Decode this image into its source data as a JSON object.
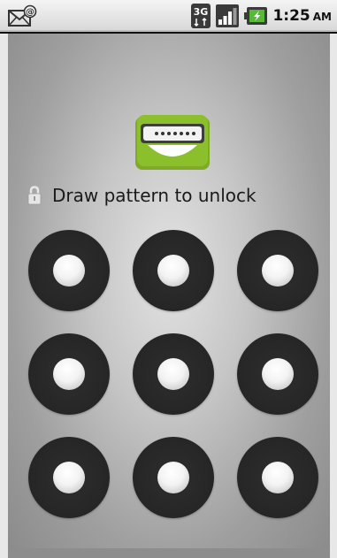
{
  "statusbar": {
    "network_label": "3G",
    "time": "1:25",
    "ampm": "AM",
    "notification_icon": "email-notification-icon",
    "signal_icon": "signal-strength-icon",
    "battery_icon": "battery-charging-icon"
  },
  "lockscreen": {
    "prompt": "Draw pattern to unlock",
    "prompt_icon": "padlock-icon",
    "logo_icon": "password-lock-icon",
    "pattern_dots": [
      {
        "row": 1,
        "col": 1
      },
      {
        "row": 1,
        "col": 2
      },
      {
        "row": 1,
        "col": 3
      },
      {
        "row": 2,
        "col": 1
      },
      {
        "row": 2,
        "col": 2
      },
      {
        "row": 2,
        "col": 3
      },
      {
        "row": 3,
        "col": 1
      },
      {
        "row": 3,
        "col": 2
      },
      {
        "row": 3,
        "col": 3
      }
    ]
  },
  "colors": {
    "logo_green": "#8bbf2c",
    "dot_ring": "#2a2a2a",
    "background_center": "#e3e3e3",
    "background_edge": "#8a8a8a"
  }
}
